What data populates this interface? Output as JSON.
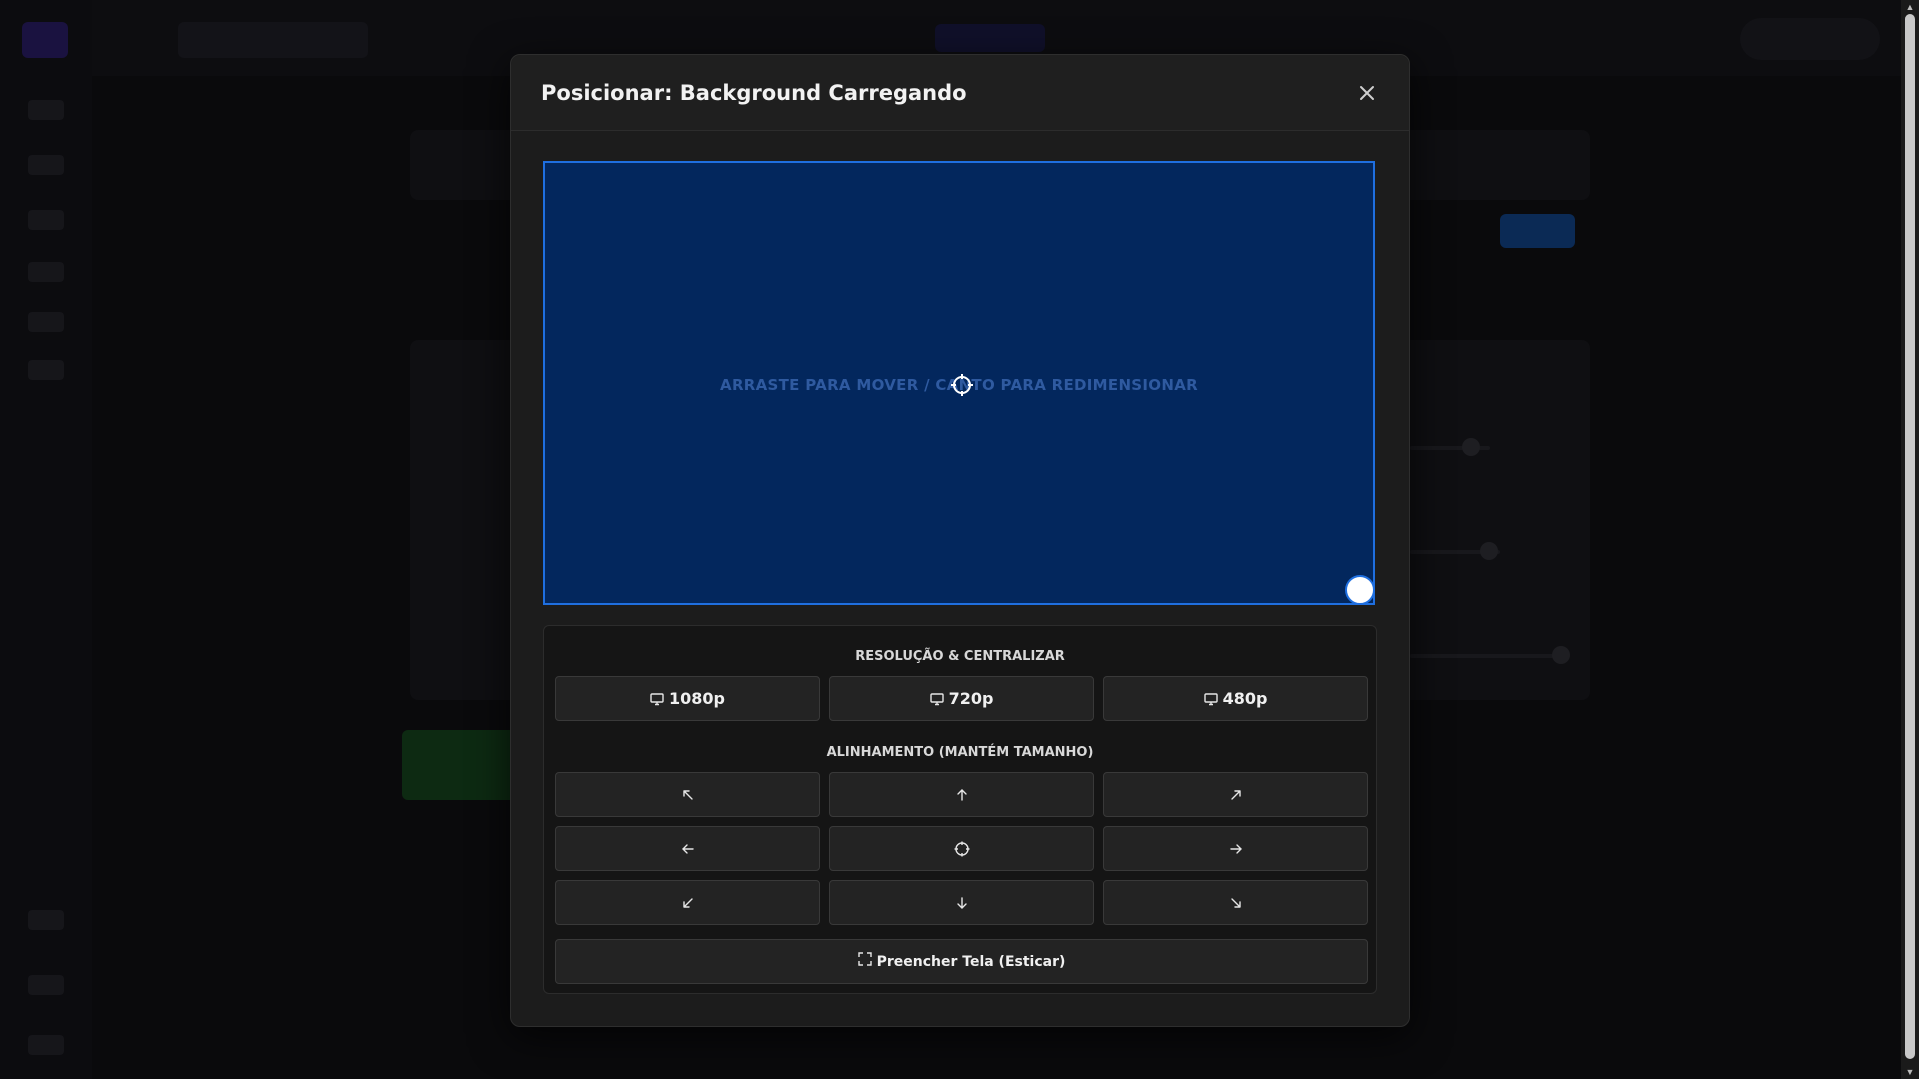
{
  "modal": {
    "title": "Posicionar: Background Carregando",
    "preview_hint": "ARRASTE PARA MOVER / CANTO PARA REDIMENSIONAR",
    "resolution_section_label": "RESOLUÇÃO & CENTRALIZAR",
    "resolutions": [
      {
        "label": "1080p",
        "icon": "monitor-icon"
      },
      {
        "label": "720p",
        "icon": "monitor-icon"
      },
      {
        "label": "480p",
        "icon": "monitor-icon"
      }
    ],
    "alignment_section_label": "ALINHAMENTO (MANTÉM TAMANHO)",
    "alignment_buttons": [
      "arrow-up-left-icon",
      "arrow-up-icon",
      "arrow-up-right-icon",
      "arrow-left-icon",
      "crosshair-icon",
      "arrow-right-icon",
      "arrow-down-left-icon",
      "arrow-down-icon",
      "arrow-down-right-icon"
    ],
    "fill_button_label": "Preencher Tela (Esticar)",
    "fill_button_icon": "expand-icon"
  },
  "colors": {
    "preview_bg": "#03275d",
    "preview_border": "#1f6fe0",
    "modal_bg": "#1c1c1c"
  }
}
